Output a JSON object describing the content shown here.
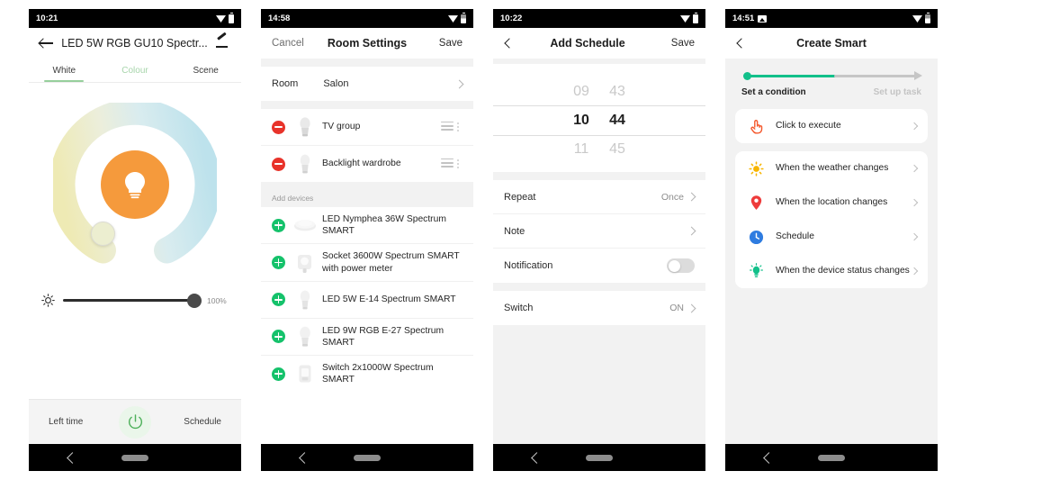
{
  "phone1": {
    "status": {
      "time": "10:21",
      "wifi_icon": "wifi-icon",
      "battery_icon": "battery-icon"
    },
    "appbar": {
      "back_icon": "arrow-back-icon",
      "title": "LED 5W RGB GU10 Spectr...",
      "edit_icon": "edit-pencil-icon"
    },
    "tabs": [
      {
        "label": "White",
        "state": "active"
      },
      {
        "label": "Colour",
        "state": "dim"
      },
      {
        "label": "Scene",
        "state": "normal"
      }
    ],
    "color_ring": {
      "warm_color": "#f0ecb8",
      "cool_color": "#bfe4ec",
      "bulb_circle_color": "#f59a3c",
      "knob_color": "#eceed0"
    },
    "brightness": {
      "icon": "brightness-icon",
      "value": "100%",
      "percent": 100
    },
    "footer": {
      "left_label": "Left time",
      "power_icon": "power-icon",
      "right_label": "Schedule"
    },
    "nav": {
      "back_icon": "nav-back-icon",
      "home_icon": "nav-home-pill"
    }
  },
  "phone2": {
    "status": {
      "time": "14:58",
      "wifi_icon": "wifi-icon",
      "battery_icon": "battery-icon"
    },
    "appbar": {
      "cancel_label": "Cancel",
      "title": "Room Settings",
      "save_label": "Save"
    },
    "room_row": {
      "label": "Room",
      "value": "Salon"
    },
    "assigned_devices": [
      {
        "name": "TV group",
        "thumb": "bulb-thumb"
      },
      {
        "name": "Backlight wardrobe",
        "thumb": "bulb-thumb"
      }
    ],
    "add_section_header": "Add devices",
    "available_devices": [
      {
        "name": "LED Nymphea 36W Spectrum SMART",
        "thumb": "ceiling-lamp-thumb"
      },
      {
        "name": "Socket 3600W Spectrum SMART with power meter",
        "thumb": "socket-thumb"
      },
      {
        "name": "LED 5W E-14 Spectrum SMART",
        "thumb": "bulb-thumb"
      },
      {
        "name": "LED 9W RGB E-27 Spectrum SMART",
        "thumb": "bulb-thumb"
      },
      {
        "name": "Switch 2x1000W Spectrum SMART",
        "thumb": "switch-thumb"
      }
    ],
    "nav": {
      "back_icon": "nav-back-icon",
      "home_icon": "nav-home-pill"
    }
  },
  "phone3": {
    "status": {
      "time": "10:22",
      "wifi_icon": "wifi-icon",
      "battery_icon": "battery-icon"
    },
    "appbar": {
      "back_icon": "chevron-back-icon",
      "title": "Add Schedule",
      "save_label": "Save"
    },
    "time_picker": {
      "prev": {
        "hour": "09",
        "minute": "43"
      },
      "selected": {
        "hour": "10",
        "minute": "44"
      },
      "next": {
        "hour": "11",
        "minute": "45"
      }
    },
    "rows": [
      {
        "label": "Repeat",
        "value": "Once",
        "control": "chevron"
      },
      {
        "label": "Note",
        "value": "",
        "control": "chevron"
      },
      {
        "label": "Notification",
        "value": "",
        "control": "toggle-off"
      }
    ],
    "switch_row": {
      "label": "Switch",
      "value": "ON",
      "control": "chevron"
    },
    "nav": {
      "back_icon": "nav-back-icon",
      "home_icon": "nav-home-pill"
    }
  },
  "phone4": {
    "status": {
      "time": "14:51",
      "photo_icon": "photo-icon",
      "wifi_icon": "wifi-icon",
      "battery_icon": "battery-icon"
    },
    "appbar": {
      "back_icon": "chevron-back-icon",
      "title": "Create Smart"
    },
    "stepper": {
      "step1_label": "Set a condition",
      "step2_label": "Set up task",
      "active_color": "#12c08a",
      "inactive_color": "#c6c6c6"
    },
    "primary_option": {
      "label": "Click to execute",
      "icon": "tap-hand-icon",
      "icon_color": "#f4582c"
    },
    "options": [
      {
        "label": "When the weather changes",
        "icon": "sun-icon",
        "icon_color": "#f7b500"
      },
      {
        "label": "When the location changes",
        "icon": "location-pin-icon",
        "icon_color": "#ee3b3b"
      },
      {
        "label": "Schedule",
        "icon": "clock-icon",
        "icon_color": "#2f7ce0"
      },
      {
        "label": "When the device status changes",
        "icon": "device-bulb-icon",
        "icon_color": "#12c08a"
      }
    ],
    "nav": {
      "back_icon": "nav-back-icon",
      "home_icon": "nav-home-pill"
    }
  }
}
